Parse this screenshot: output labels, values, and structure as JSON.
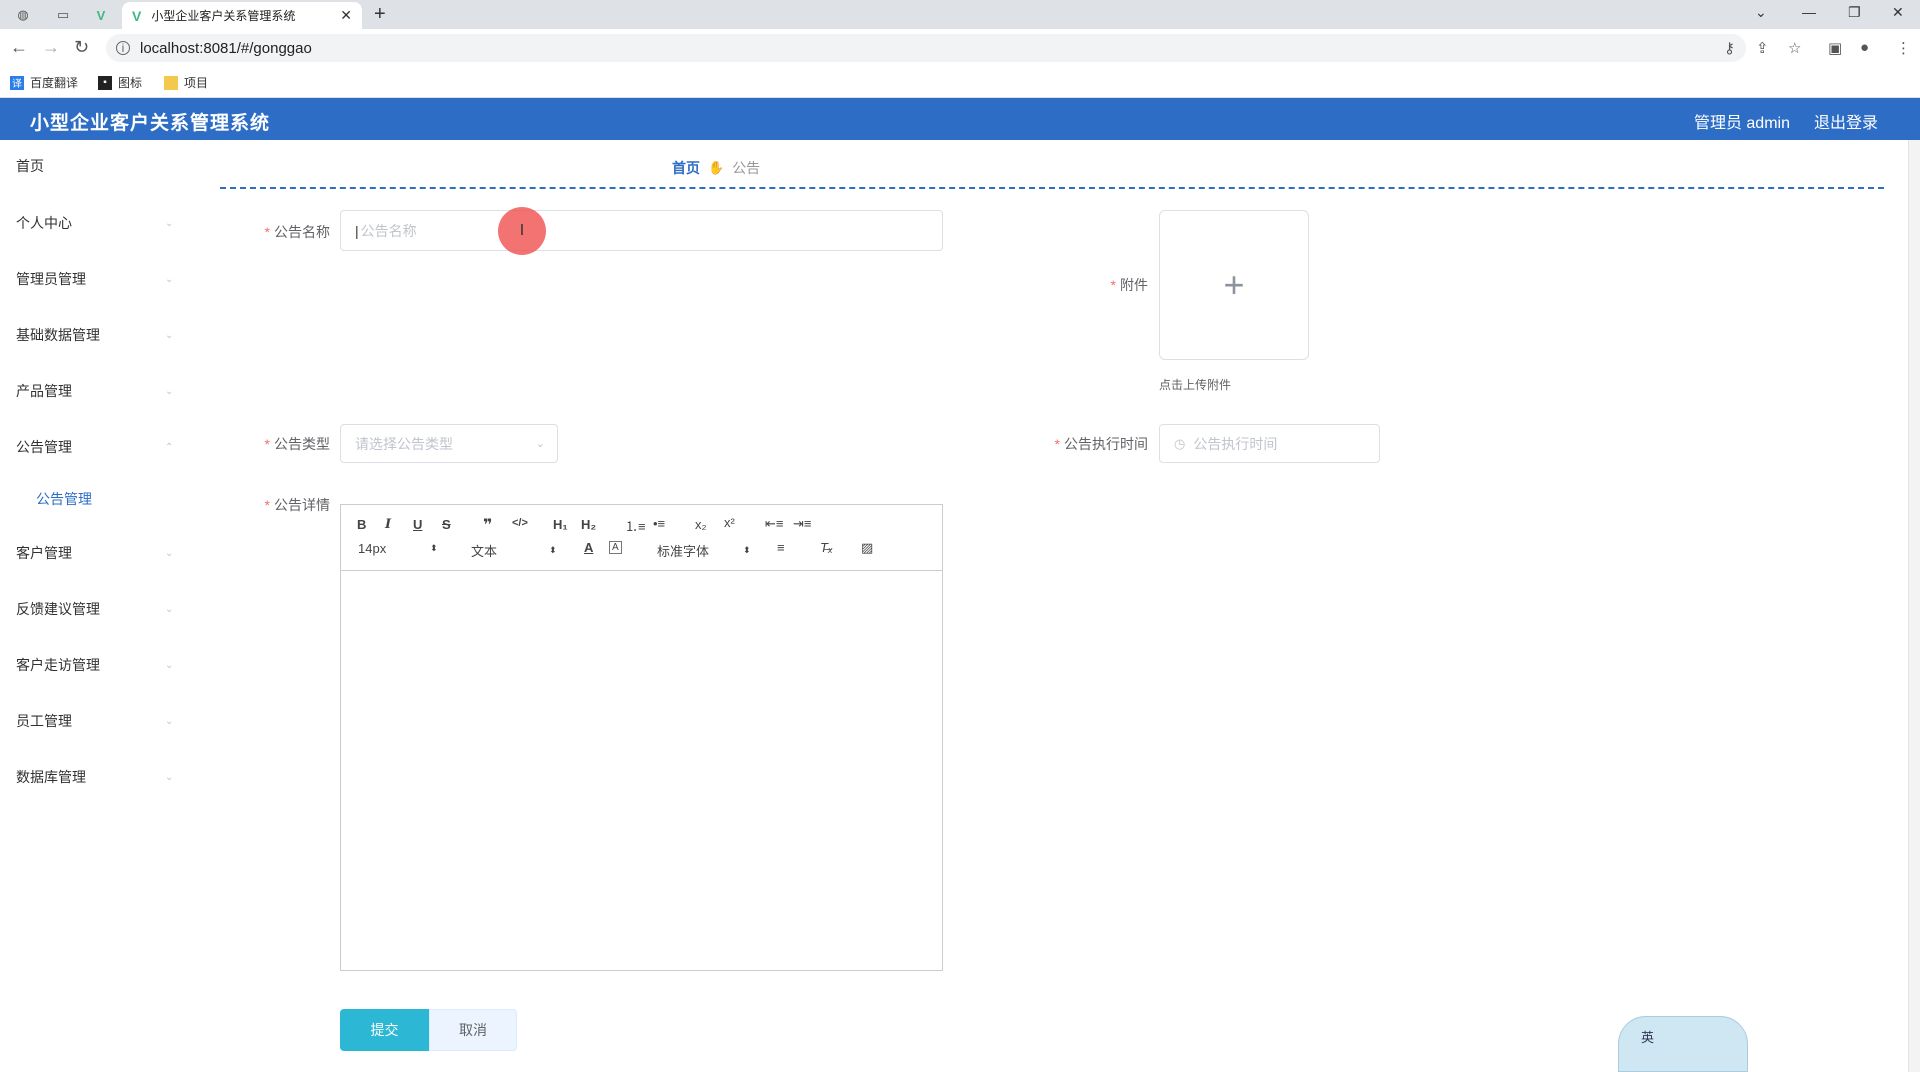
{
  "browser": {
    "tab_title": "小型企业客户关系管理系统",
    "url": "localhost:8081/#/gonggao",
    "bookmarks": [
      "百度翻译",
      "图标",
      "项目"
    ]
  },
  "header": {
    "title": "小型企业客户关系管理系统",
    "user_label": "管理员 admin",
    "logout_label": "退出登录"
  },
  "sidebar": {
    "items": [
      {
        "label": "首页"
      },
      {
        "label": "个人中心"
      },
      {
        "label": "管理员管理"
      },
      {
        "label": "基础数据管理"
      },
      {
        "label": "产品管理"
      },
      {
        "label": "公告管理"
      },
      {
        "label": "公告管理"
      },
      {
        "label": "客户管理"
      },
      {
        "label": "反馈建议管理"
      },
      {
        "label": "客户走访管理"
      },
      {
        "label": "员工管理"
      },
      {
        "label": "数据库管理"
      }
    ]
  },
  "breadcrumb": {
    "home": "首页",
    "current": "公告"
  },
  "form": {
    "name_label": "公告名称",
    "name_placeholder": "公告名称",
    "attachment_label": "附件",
    "upload_tip": "点击上传附件",
    "type_label": "公告类型",
    "type_placeholder": "请选择公告类型",
    "time_label": "公告执行时间",
    "time_placeholder": "公告执行时间",
    "detail_label": "公告详情"
  },
  "editor": {
    "font_size": "14px",
    "header_select": "文本",
    "font_family": "标准字体"
  },
  "buttons": {
    "submit": "提交",
    "cancel": "取消"
  },
  "ime": {
    "mode": "英"
  }
}
